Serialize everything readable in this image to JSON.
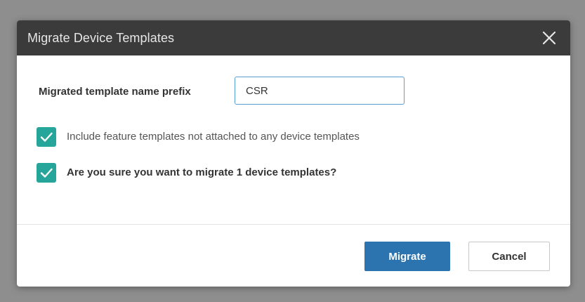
{
  "dialog": {
    "title": "Migrate Device Templates",
    "close_icon": "close-icon",
    "prefix_field": {
      "label": "Migrated template name prefix",
      "value": "CSR"
    },
    "options": [
      {
        "label": "Include feature templates not attached to any device templates",
        "checked": true
      },
      {
        "label": "Are you sure you want to migrate 1 device templates?",
        "checked": true
      }
    ],
    "buttons": {
      "migrate": "Migrate",
      "cancel": "Cancel"
    }
  },
  "colors": {
    "header_bg": "#3b3b3b",
    "checkbox": "#26a69a",
    "primary_button": "#2b74b0",
    "input_border": "#5a9fd4"
  }
}
